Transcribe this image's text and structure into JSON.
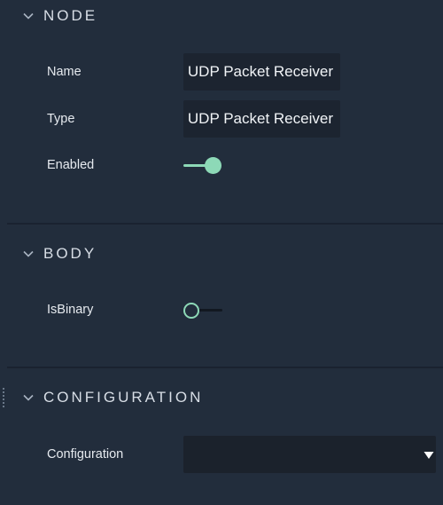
{
  "sections": {
    "node": {
      "title": "NODE",
      "name_label": "Name",
      "name_value": "UDP Packet Receiver",
      "type_label": "Type",
      "type_value": "UDP Packet Receiver",
      "enabled_label": "Enabled",
      "enabled_value": true
    },
    "body": {
      "title": "BODY",
      "isbinary_label": "IsBinary",
      "isbinary_value": false
    },
    "configuration": {
      "title": "CONFIGURATION",
      "configuration_label": "Configuration",
      "configuration_value": ""
    }
  },
  "icons": {
    "section_toggle": "chevron-down-icon",
    "dropdown": "triangle-down-icon",
    "resize": "drag-handle-icon"
  },
  "colors": {
    "background": "#222d3c",
    "field_background": "#1c2430",
    "accent": "#8dd9b7",
    "divider": "#1a2230"
  }
}
